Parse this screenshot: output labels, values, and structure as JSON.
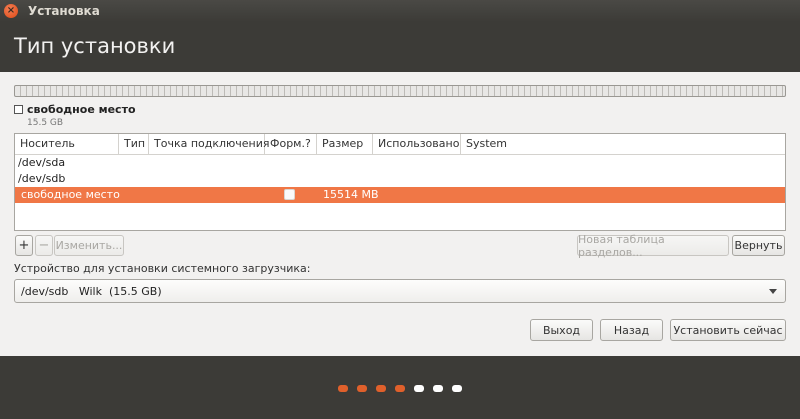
{
  "window": {
    "title": "Установка",
    "close_glyph": "×"
  },
  "page": {
    "title": "Тип установки"
  },
  "partition_bar": {
    "legend_label": "свободное место",
    "legend_size": "15.5 GB"
  },
  "table": {
    "headers": [
      "Носитель",
      "Тип",
      "Точка подключения",
      "Форм.?",
      "Размер",
      "Использовано",
      "System"
    ],
    "rows": [
      {
        "device": "/dev/sda"
      },
      {
        "device": "/dev/sdb"
      },
      {
        "device": "свободное место",
        "format": false,
        "size": "15514 MB",
        "selected": true
      }
    ]
  },
  "toolbar": {
    "add_label": "+",
    "remove_label": "−",
    "change_label": "Изменить...",
    "new_table_label": "Новая таблица разделов...",
    "revert_label": "Вернуть"
  },
  "bootloader": {
    "label": "Устройство для установки системного загрузчика:",
    "selected": "/dev/sdb   Wilk  (15.5 GB)"
  },
  "actions": {
    "quit_label": "Выход",
    "back_label": "Назад",
    "install_label": "Установить сейчас"
  },
  "progress": {
    "total_steps": 7,
    "completed_steps": 4,
    "active_color": "#e0602b",
    "inactive_color": "#ffffff"
  },
  "colors": {
    "accent": "#f07746",
    "dark": "#3c3b37"
  }
}
